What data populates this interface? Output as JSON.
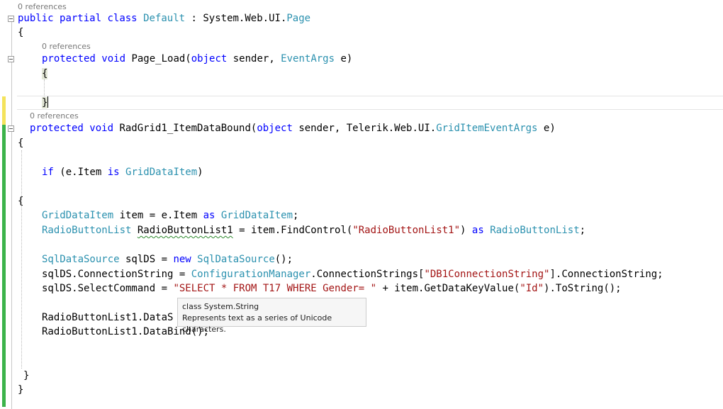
{
  "colors": {
    "keyword": "#0000ff",
    "type": "#2b91af",
    "string": "#a31515",
    "modified_yellow": "#f4e35c",
    "saved_green": "#3cb34a"
  },
  "codelens": {
    "class_refs": "0 references",
    "page_load_refs": "0 references",
    "itemdatabound_refs": "0 references"
  },
  "code": {
    "l1": {
      "kw1": "public",
      "kw2": "partial",
      "kw3": "class",
      "type1": "Default",
      "t1": " : System.Web.UI.",
      "type2": "Page"
    },
    "l2": "{",
    "l3": {
      "kw1": "protected",
      "kw2": "void",
      "t1": " Page_Load(",
      "kw3": "object",
      "t2": " sender, ",
      "type1": "EventArgs",
      "t3": " e)"
    },
    "l4": "{",
    "l6": "}",
    "l7": {
      "kw1": "protected",
      "kw2": "void",
      "t1": " RadGrid1_ItemDataBound(",
      "kw3": "object",
      "t2": " sender, Telerik.Web.UI.",
      "type1": "GridItemEventArgs",
      "t3": " e)"
    },
    "l8": "{",
    "l10": {
      "kw1": "if",
      "t1": " (e.Item ",
      "kw2": "is",
      "type1": "GridDataItem",
      "t2": ")"
    },
    "l12": "{",
    "l14": {
      "type1": "GridDataItem",
      "t1": " item = e.Item ",
      "kw1": "as",
      "type2": "GridDataItem",
      "t2": ";"
    },
    "l15": {
      "type1": "RadioButtonList",
      "sq": "RadioButtonList1",
      "t1": " = item.FindControl(",
      "str1": "\"RadioButtonList1\"",
      "t2": ") ",
      "kw1": "as",
      "type2": "RadioButtonList",
      "t3": ";"
    },
    "l17": {
      "type1": "SqlDataSource",
      "t1": " sqlDS = ",
      "kw1": "new",
      "type2": "SqlDataSource",
      "t2": "();"
    },
    "l18": {
      "t1": "sqlDS.ConnectionString = ",
      "type1": "ConfigurationManager",
      "t2": ".ConnectionStrings[",
      "str1": "\"DB1ConnectionString\"",
      "t3": "].ConnectionString;"
    },
    "l19": {
      "t1": "sqlDS.SelectCommand = ",
      "str1": "\"SELECT * FROM T17 WHERE Gender= \"",
      "t2": " + item.GetDataKeyValue(",
      "str2": "\"Id\"",
      "t3": ").ToString();"
    },
    "l21": "RadioButtonList1.DataS",
    "l22": "RadioButtonList1.DataBind();",
    "l25": "}",
    "l26": "}"
  },
  "tooltip": {
    "title": "class System.String",
    "description": "Represents text as a series of Unicode characters."
  }
}
